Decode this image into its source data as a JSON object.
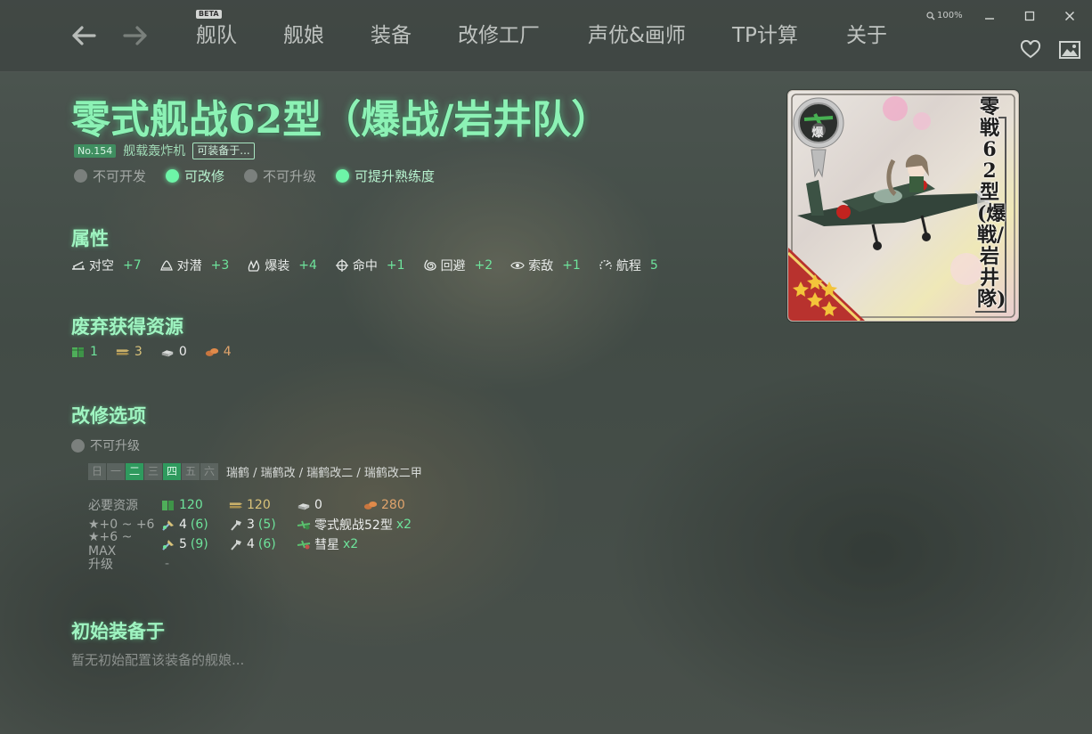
{
  "nav": {
    "beta_badge": "BETA",
    "tabs": [
      "舰队",
      "舰娘",
      "装备",
      "改修工厂",
      "声优&画师",
      "TP计算",
      "关于"
    ],
    "zoom": "100%"
  },
  "equipment": {
    "title": "零式舰战62型（爆战/岩井队）",
    "number": "No.154",
    "type": "舰载轰炸机",
    "can_equip_label": "可装备于...",
    "flags": [
      {
        "label": "不可开发",
        "on": false
      },
      {
        "label": "可改修",
        "on": true
      },
      {
        "label": "不可升级",
        "on": false
      },
      {
        "label": "可提升熟练度",
        "on": true
      }
    ],
    "card_name": "零戦62型(爆戦/岩井隊)",
    "card_badge": "爆"
  },
  "attributes": {
    "heading": "属性",
    "stats": [
      {
        "icon": "anti-air-icon",
        "name": "对空",
        "value": "+7"
      },
      {
        "icon": "anti-sub-icon",
        "name": "对潜",
        "value": "+3"
      },
      {
        "icon": "bombing-icon",
        "name": "爆装",
        "value": "+4"
      },
      {
        "icon": "accuracy-icon",
        "name": "命中",
        "value": "+1"
      },
      {
        "icon": "evasion-icon",
        "name": "回避",
        "value": "+2"
      },
      {
        "icon": "los-icon",
        "name": "索敌",
        "value": "+1"
      },
      {
        "icon": "range-icon",
        "name": "航程",
        "value": "5"
      }
    ]
  },
  "scrap": {
    "heading": "废弃获得资源",
    "resources": [
      {
        "icon": "fuel-icon",
        "value": "1",
        "color": "#6ee39b"
      },
      {
        "icon": "ammo-icon",
        "value": "3",
        "color": "#d9c37a"
      },
      {
        "icon": "steel-icon",
        "value": "0",
        "color": "#e6e6e6"
      },
      {
        "icon": "bauxite-icon",
        "value": "4",
        "color": "#e0a46c"
      }
    ]
  },
  "improvement": {
    "heading": "改修选项",
    "upgrade_status": "不可升级",
    "days": [
      {
        "label": "日",
        "on": false
      },
      {
        "label": "一",
        "on": false
      },
      {
        "label": "二",
        "on": true
      },
      {
        "label": "三",
        "on": false
      },
      {
        "label": "四",
        "on": true
      },
      {
        "label": "五",
        "on": false
      },
      {
        "label": "六",
        "on": false
      }
    ],
    "ships": "瑞鹤 / 瑞鹤改 / 瑞鹤改二 / 瑞鹤改二甲",
    "required_label": "必要资源",
    "required": {
      "fuel": "120",
      "ammo": "120",
      "steel": "0",
      "bauxite": "280"
    },
    "rows": [
      {
        "label": "★+0 ~ +6",
        "dev": "4",
        "dev_sure": "(6)",
        "screw": "3",
        "screw_sure": "(5)",
        "item": "零式舰战52型",
        "item_count": "x2"
      },
      {
        "label": "★+6 ~ MAX",
        "dev": "5",
        "dev_sure": "(9)",
        "screw": "4",
        "screw_sure": "(6)",
        "item": "彗星",
        "item_count": "x2"
      }
    ],
    "upgrade_label": "升级",
    "upgrade_value": "-"
  },
  "initial": {
    "heading": "初始装备于",
    "text": "暂无初始配置该装备的舰娘..."
  }
}
